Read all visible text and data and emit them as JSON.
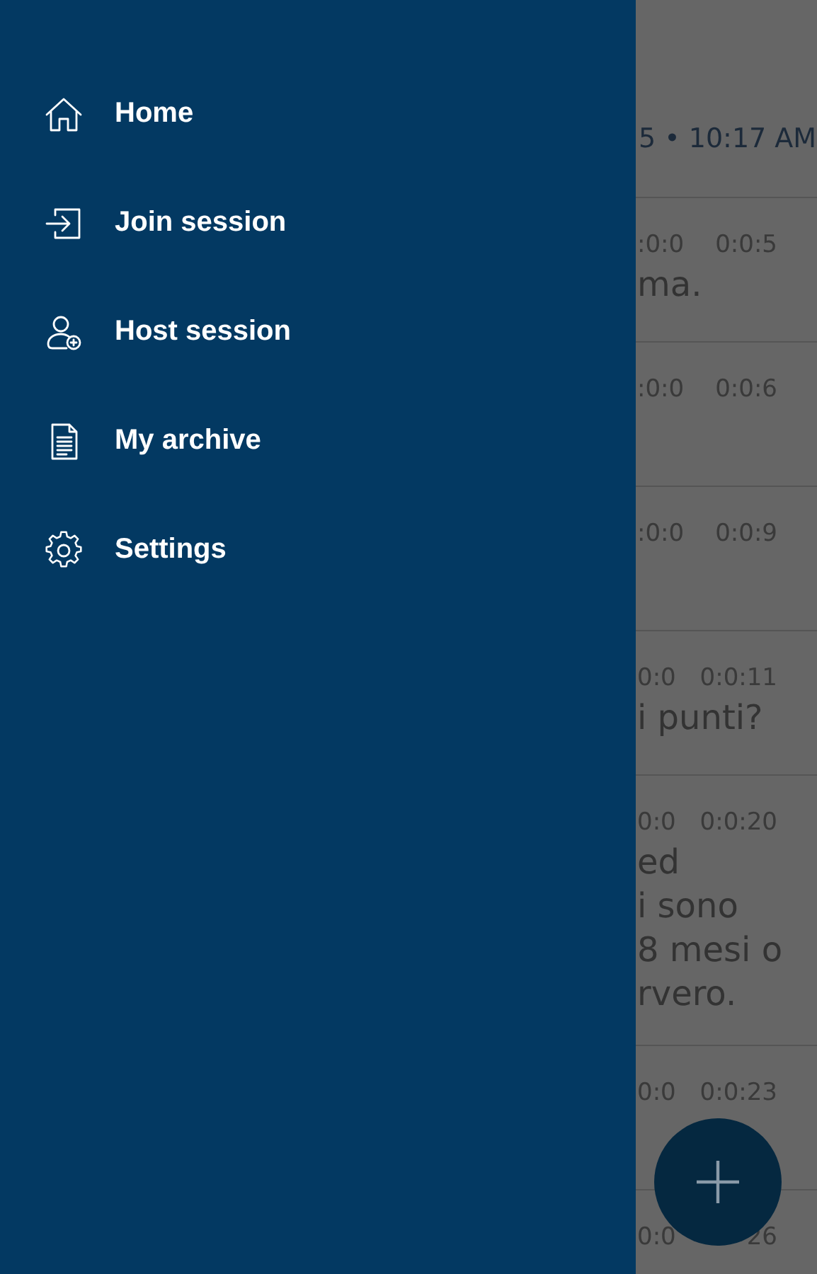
{
  "drawer": {
    "items": [
      {
        "label": "Home",
        "kind": "home"
      },
      {
        "label": "Join session",
        "kind": "enter"
      },
      {
        "label": "Host session",
        "kind": "host"
      },
      {
        "label": "My archive",
        "kind": "archive"
      },
      {
        "label": "Settings",
        "kind": "settings"
      }
    ]
  },
  "content": {
    "header_time": "5 • 10:17 AM",
    "rows": [
      {
        "start": ":0:0",
        "end": "0:0:5",
        "lines": [
          "ma."
        ]
      },
      {
        "start": ":0:0",
        "end": "0:0:6",
        "lines": []
      },
      {
        "start": ":0:0",
        "end": "0:0:9",
        "lines": []
      },
      {
        "start": "0:0",
        "end": "0:0:11",
        "lines": [
          "i punti?"
        ]
      },
      {
        "start": "0:0",
        "end": "0:0:20",
        "lines": [
          "ed",
          "i sono",
          "8 mesi o",
          "rvero."
        ]
      },
      {
        "start": "0:0",
        "end": "0:0:23",
        "lines": []
      },
      {
        "start": "0:0",
        "end": "26",
        "lines": []
      }
    ]
  }
}
